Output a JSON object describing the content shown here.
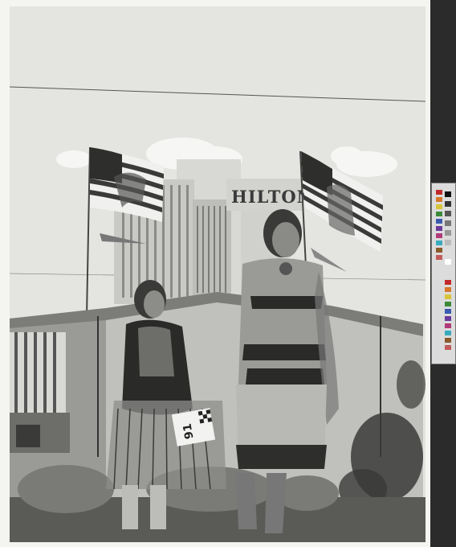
{
  "photo": {
    "sign_text": "HILTON",
    "bib_number": "91",
    "palette": {
      "sky": "#e6e6e3",
      "cloud": "#f7f7f5",
      "building": "#cfcfcc",
      "tent": "#bdbdba",
      "ground": "#5a5a56",
      "figure_dark": "#2a2a28",
      "figure_mid": "#6b6b68"
    }
  },
  "color_chart": {
    "swatches": [
      "#c22a2a",
      "#d8782a",
      "#d8c43a",
      "#3a8a3a",
      "#3a5ab0",
      "#6a3a9a",
      "#b03a7a",
      "#3aaac0",
      "#8a5a2a",
      "#c25a5a"
    ],
    "grays": [
      "#111111",
      "#333333",
      "#555555",
      "#777777",
      "#999999",
      "#bbbbbb",
      "#dddddd",
      "#ffffff"
    ]
  }
}
